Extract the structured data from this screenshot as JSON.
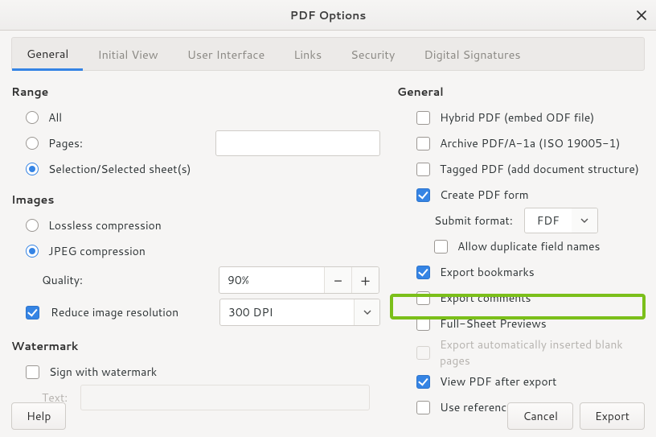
{
  "title": "PDF Options",
  "tabs": [
    "General",
    "Initial View",
    "User Interface",
    "Links",
    "Security",
    "Digital Signatures"
  ],
  "active_tab": 0,
  "left": {
    "range_h": "Range",
    "all": "All",
    "pages": "Pages:",
    "selection": "Selection/Selected sheet(s)",
    "images_h": "Images",
    "lossless": "Lossless compression",
    "jpeg": "JPEG compression",
    "quality_lbl": "Quality:",
    "quality_val": "90%",
    "reduce": "Reduce image resolution",
    "reduce_val": "300 DPI",
    "watermark_h": "Watermark",
    "sign_wm": "Sign with watermark",
    "text_lbl": "Text:"
  },
  "right": {
    "general_h": "General",
    "hybrid": "Hybrid PDF (embed ODF file)",
    "archive": "Archive PDF/A-1a (ISO 19005-1)",
    "tagged": "Tagged PDF (add document structure)",
    "create_form": "Create PDF form",
    "submit_lbl": "Submit format:",
    "submit_val": "FDF",
    "allow_dup": "Allow duplicate field names",
    "bookmarks": "Export bookmarks",
    "comments": "Export comments",
    "fullsheet": "Full-Sheet Previews",
    "blankpages": "Export automatically inserted blank pages",
    "viewafter": "View PDF after export",
    "xobjects": "Use reference XObjects"
  },
  "buttons": {
    "help": "Help",
    "cancel": "Cancel",
    "export": "Export"
  }
}
